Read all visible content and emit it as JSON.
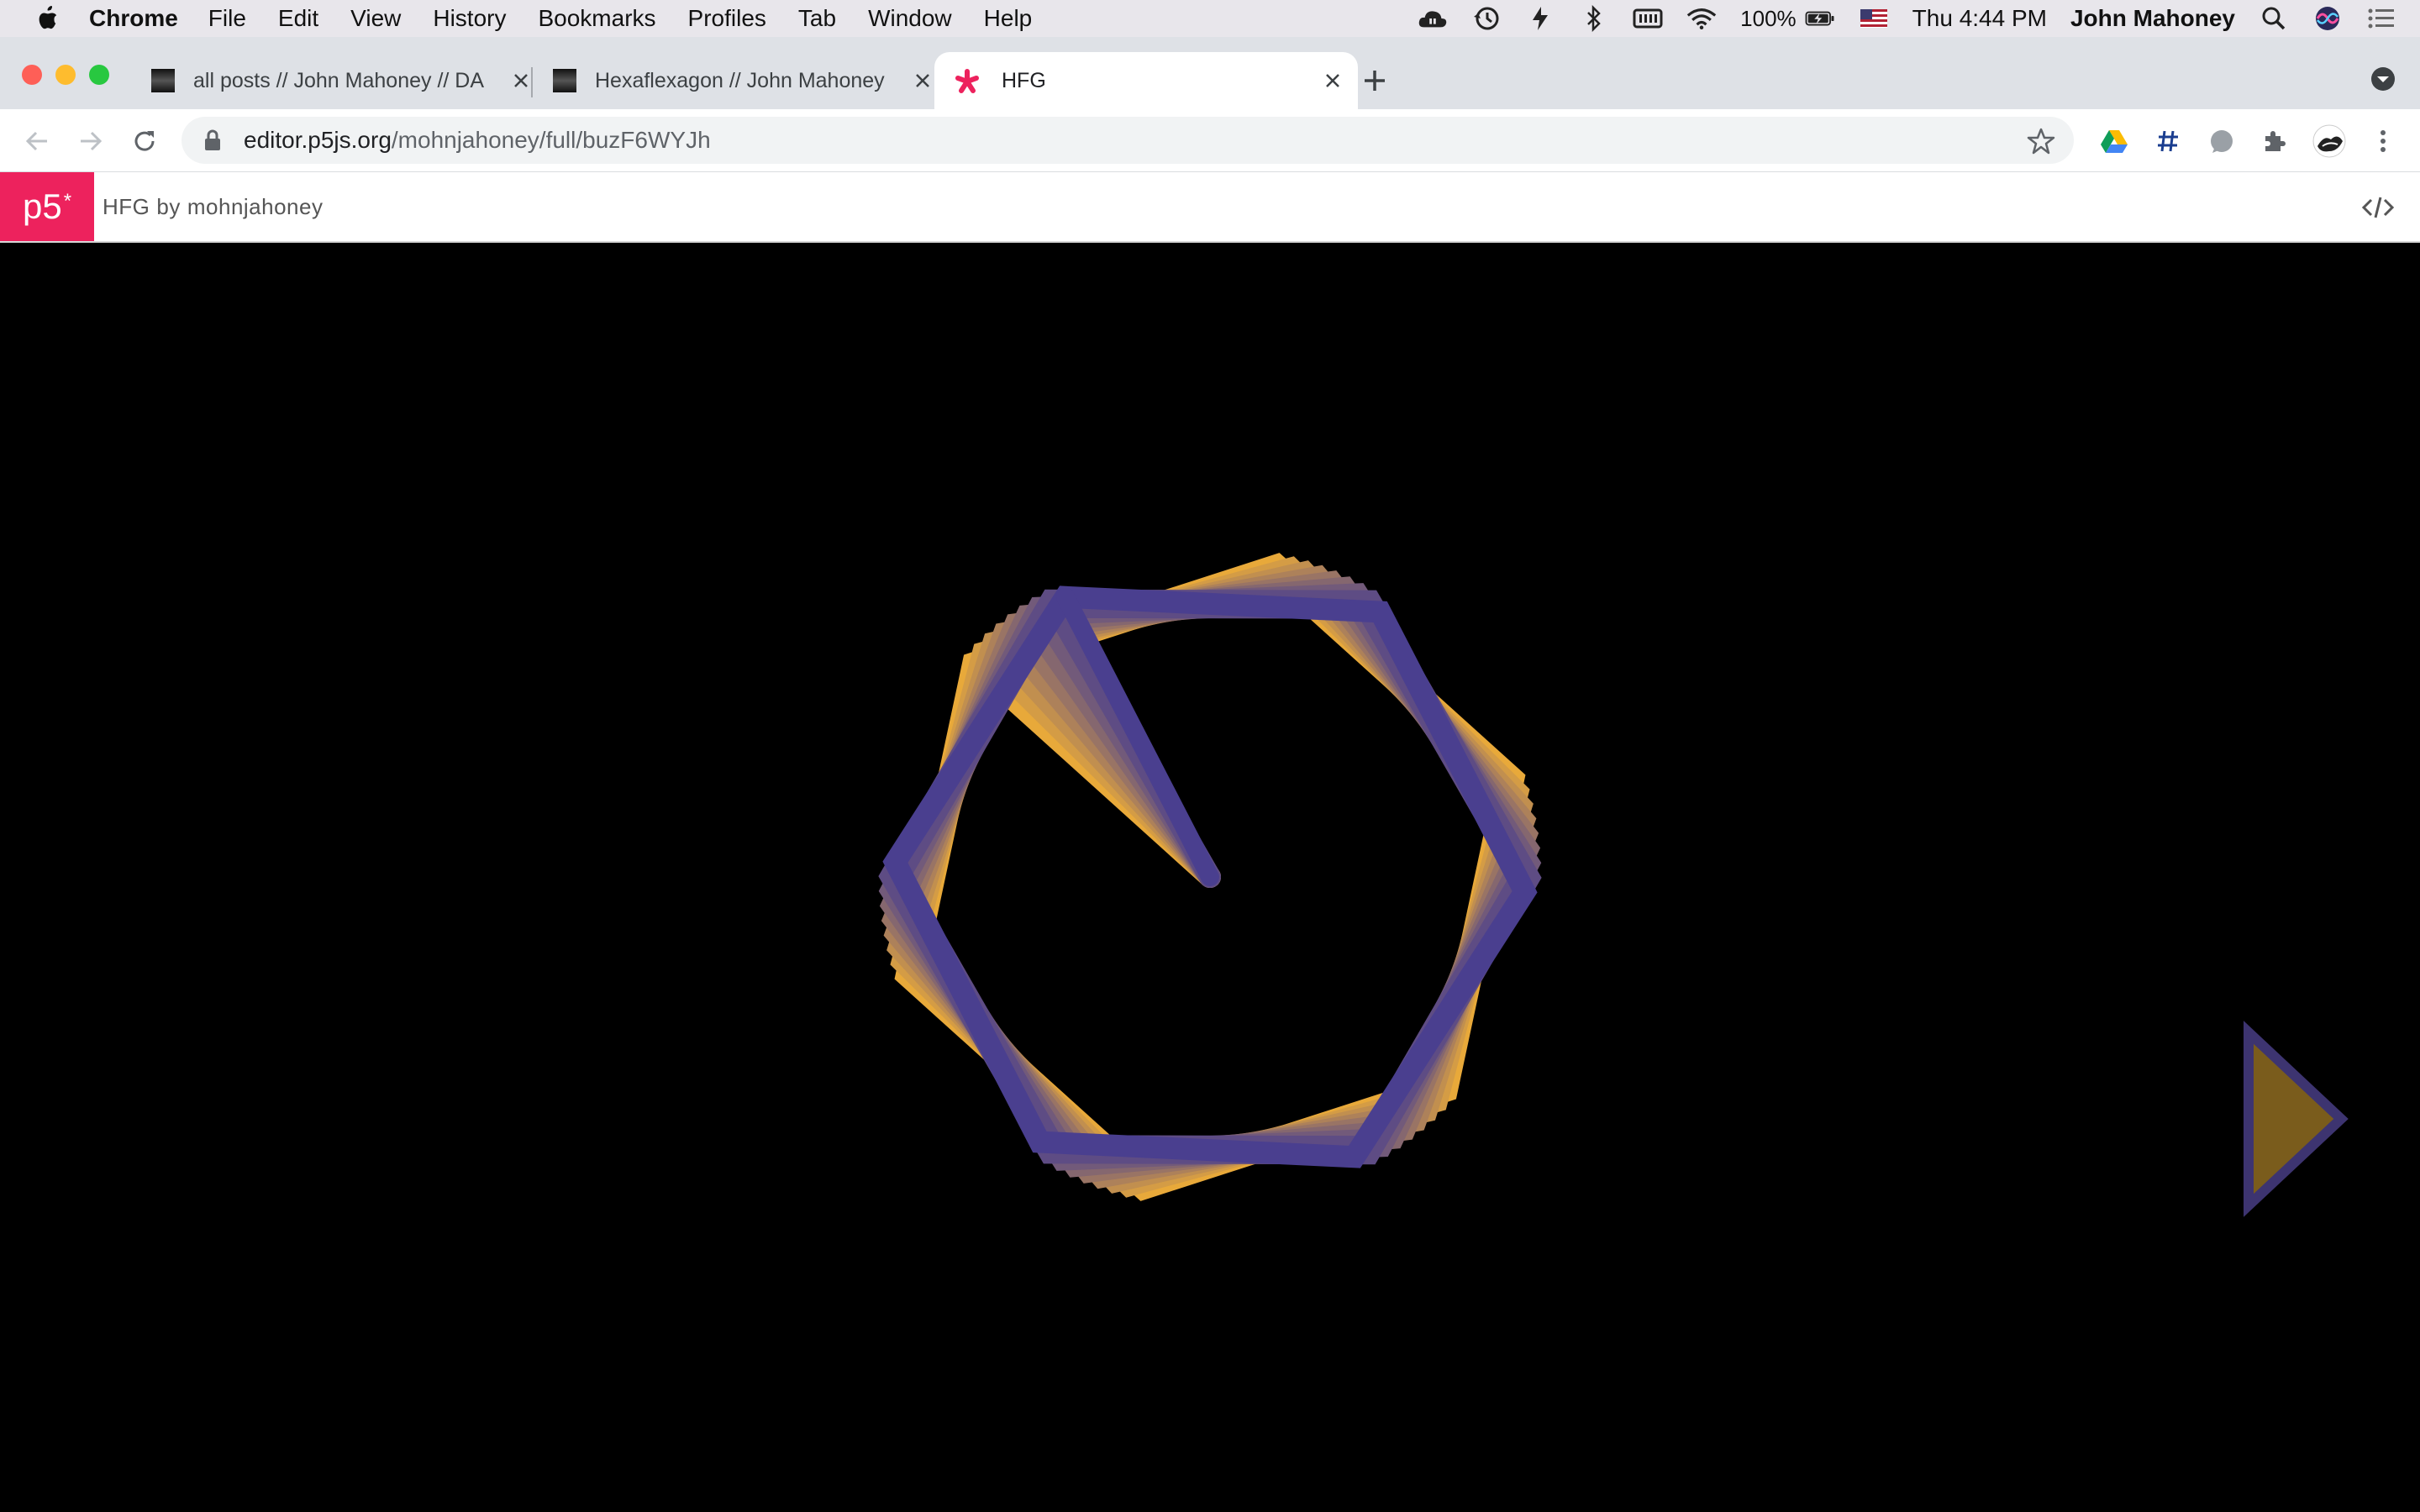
{
  "menubar": {
    "app_name": "Chrome",
    "menus": [
      "File",
      "Edit",
      "View",
      "History",
      "Bookmarks",
      "Profiles",
      "Tab",
      "Window",
      "Help"
    ],
    "battery": "100%",
    "clock": "Thu 4:44 PM",
    "user": "John Mahoney"
  },
  "tabs": [
    {
      "title": "all posts // John Mahoney // DA",
      "active": false
    },
    {
      "title": "Hexaflexagon // John Mahoney",
      "active": false
    },
    {
      "title": "HFG",
      "active": true
    }
  ],
  "omnibox": {
    "domain": "editor.p5js.org",
    "path": "/mohnjahoney/full/buzF6WYJh"
  },
  "p5": {
    "logo": "p5",
    "logo_asterisk": "*",
    "sketch_name": "HFG",
    "by": "by",
    "author": "mohnjahoney"
  },
  "colors": {
    "p5_pink": "#ed225d",
    "polygon_stroke": "#4a3f8f",
    "polygon_fill_trail": "#e8a93a",
    "arrow_fill": "#7a5c1c",
    "arrow_stroke": "#3d3470"
  },
  "icons": {
    "apple": "apple-icon",
    "new_tab": "plus-icon",
    "back": "arrow-left-icon",
    "forward": "arrow-right-icon",
    "reload": "reload-icon",
    "bookmark": "star-icon",
    "code_view": "code-icon",
    "next_arrow": "play-triangle-icon"
  }
}
